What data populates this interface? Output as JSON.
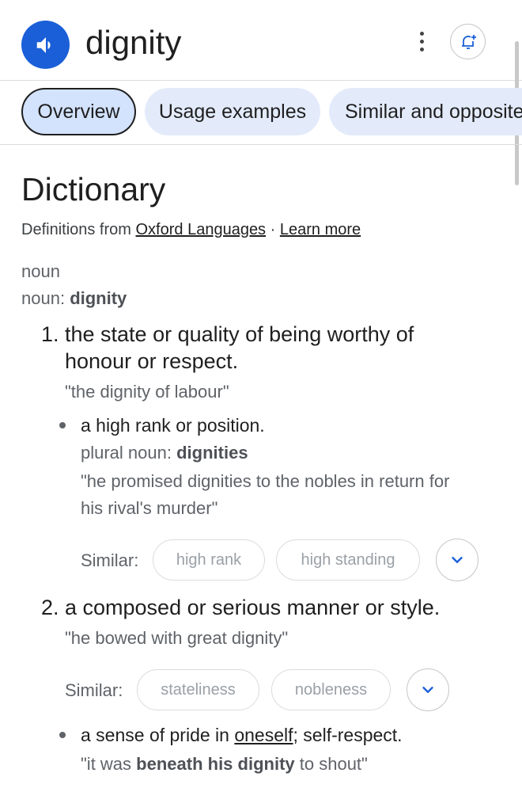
{
  "header": {
    "word": "dignity",
    "speaker_icon": "speaker-icon",
    "more_icon": "more-vert-icon",
    "bell_icon": "bell-add-icon"
  },
  "tabs": [
    {
      "label": "Overview",
      "active": true
    },
    {
      "label": "Usage examples",
      "active": false
    },
    {
      "label": "Similar and opposite",
      "active": false
    }
  ],
  "dictionary": {
    "heading": "Dictionary",
    "source_prefix": "Definitions from",
    "source_link": "Oxford Languages",
    "separator": "·",
    "learn_more": "Learn more"
  },
  "entry": {
    "pos": "noun",
    "pos_prefix": "noun:",
    "pos_word": "dignity",
    "senses": [
      {
        "number": "1.",
        "definition_line1": "the state or quality of being worthy of",
        "definition_line2": "honour or respect.",
        "example": "\"the dignity of labour\"",
        "subsense": {
          "definition": "a high rank or position.",
          "plural_prefix": "plural noun:",
          "plural_word": "dignities",
          "example_line1": "\"he promised dignities to the nobles in return for",
          "example_line2": "his rival's murder\""
        },
        "similar_label": "Similar:",
        "similar": [
          "high rank",
          "high standing"
        ]
      },
      {
        "number": "2.",
        "definition_line1": "a composed or serious manner or style.",
        "example": "\"he bowed with great dignity\"",
        "similar_label": "Similar:",
        "similar": [
          "stateliness",
          "nobleness"
        ],
        "subsense": {
          "def_link": "oneself",
          "def_rest": "; self-respect.",
          "def_prefix": "a sense of pride in",
          "example_pre": "\"it was",
          "example_bold": "beneath his dignity",
          "example_post": "to shout\""
        }
      }
    ]
  },
  "colors": {
    "accent": "#1a5fd8",
    "tab_bg": "#e3ebfb",
    "tab_active_bg": "#d3e3fd"
  }
}
